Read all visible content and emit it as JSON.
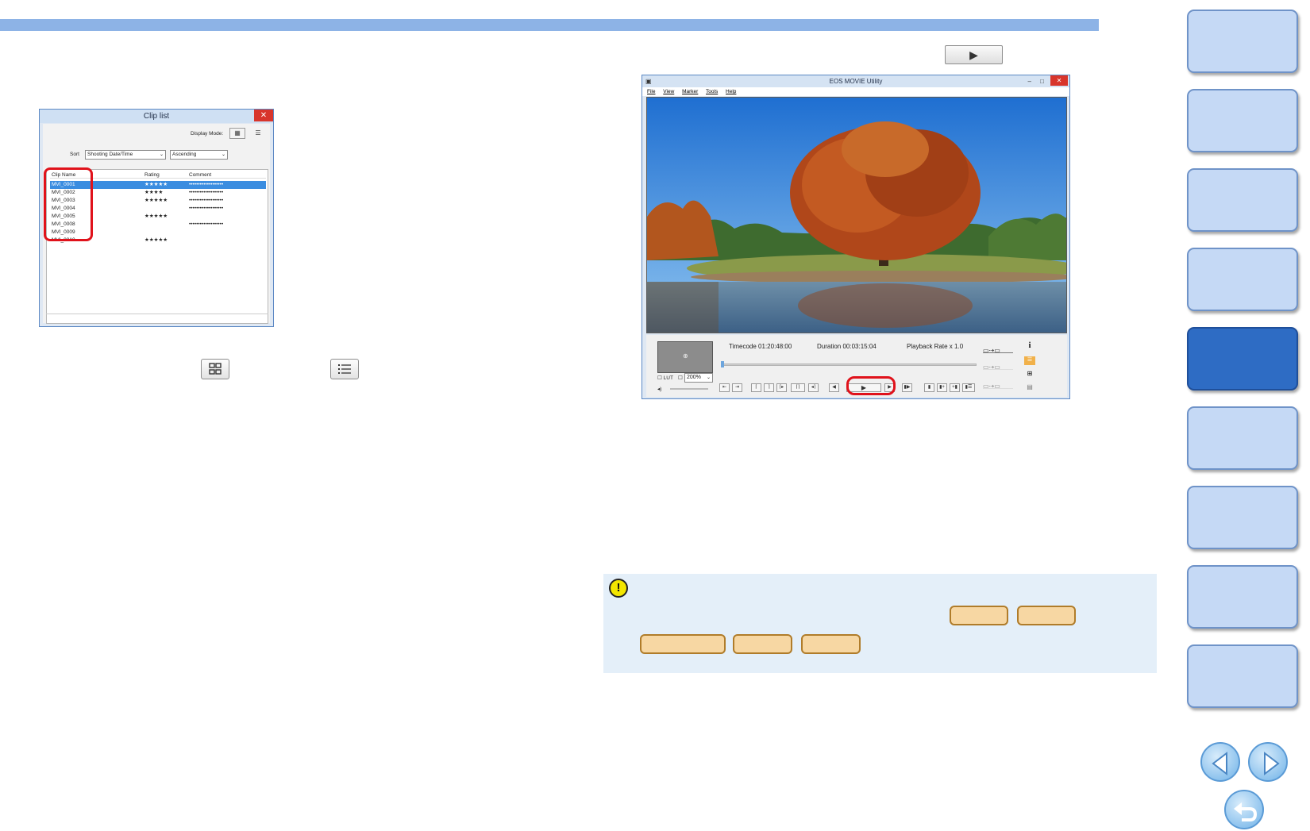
{
  "clip_list": {
    "title": "Clip list",
    "close": "✕",
    "display_mode_label": "Display Mode:",
    "sort_label": "Sort",
    "sort_value": "Shooting Date/Time",
    "order_value": "Ascending",
    "columns": [
      "Clip Name",
      "Rating",
      "Comment"
    ],
    "rows": [
      {
        "name": "MVI_0001",
        "rating": "★★★★★",
        "comment": "•••••••••••••••••••"
      },
      {
        "name": "MVI_0002",
        "rating": "★★★★",
        "comment": "•••••••••••••••••••"
      },
      {
        "name": "MVI_0003",
        "rating": "★★★★★",
        "comment": "•••••••••••••••••••"
      },
      {
        "name": "MVI_0004",
        "rating": "",
        "comment": "•••••••••••••••••••"
      },
      {
        "name": "MVI_0005",
        "rating": "★★★★★",
        "comment": ""
      },
      {
        "name": "MVI_0008",
        "rating": "",
        "comment": "•••••••••••••••••••"
      },
      {
        "name": "MVI_0009",
        "rating": "",
        "comment": ""
      },
      {
        "name": "MVI_0010",
        "rating": "★★★★★",
        "comment": ""
      }
    ]
  },
  "eos_window": {
    "title": "EOS MOVIE Utility",
    "menu": [
      "File",
      "View",
      "Marker",
      "Tools",
      "Help"
    ],
    "timecode": "Timecode 01:20:48:00",
    "duration": "Duration 00:03:15:04",
    "playback_rate": "Playback Rate x 1.0",
    "lut_label": "LUT",
    "zoom": "200%",
    "info_icon_label": "i"
  },
  "play_symbol": "▶",
  "caution_symbol": "!",
  "colors": {
    "top_bar": "#8db3e6",
    "sidebar_tab": "#c5d9f5",
    "sidebar_tab_active": "#2e6cc4",
    "highlight_ring": "#e0121b",
    "caution_bg": "#e4eff9",
    "pill_fill": "#f7d7a3"
  }
}
